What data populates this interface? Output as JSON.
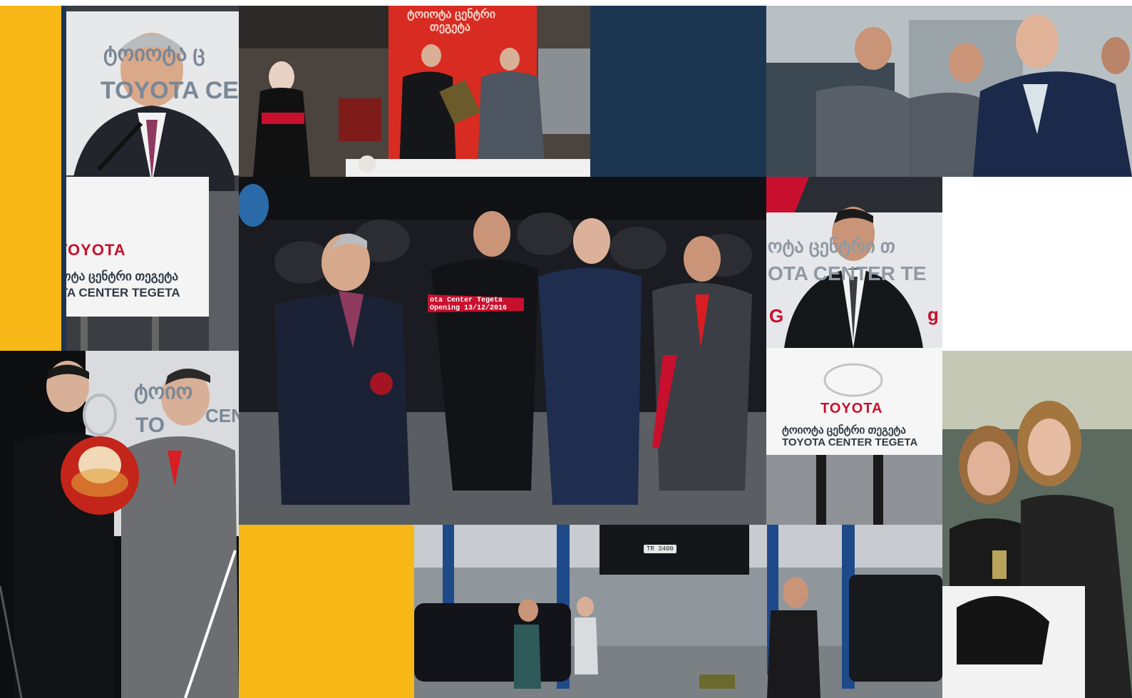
{
  "colors": {
    "accent_yellow": "#f8b817",
    "navy": "#1c3652",
    "toyota_red": "#c8102e",
    "night": "#14171c"
  },
  "tiles": {
    "speaker_1": {
      "backdrop_line_1": "ტოიოტა ც",
      "backdrop_line_2": "TOYOTA CE",
      "podium_brand": "TOYOTA",
      "podium_line_1": "ტოიოტა ცენტრი თეგეტა",
      "podium_line_2": "TOYOTA CENTER TEGETA"
    },
    "plaque": {
      "banner_text_1": "ტოიოტა ცენტრი",
      "banner_text_2": "თეგეტა"
    },
    "ribbon": {
      "ribbon_text": "ota Center Tegeta Opening 13/12/2016"
    },
    "speaker_2": {
      "backdrop_line_1": "ოტა ცენტრი თ",
      "backdrop_line_2": "OTA CENTER TE",
      "backdrop_line_3": "G",
      "backdrop_line_4": "g",
      "podium_brand": "TOYOTA",
      "podium_line_1": "ტოიოტა ცენტრი თეგეტა",
      "podium_line_2": "TOYOTA CENTER TEGETA"
    },
    "daruma": {
      "backdrop_line_1": "ტოიო",
      "backdrop_line_2": "TO",
      "backdrop_line_3": "CEN"
    },
    "garage": {
      "plate_text": "TR 3400"
    }
  }
}
